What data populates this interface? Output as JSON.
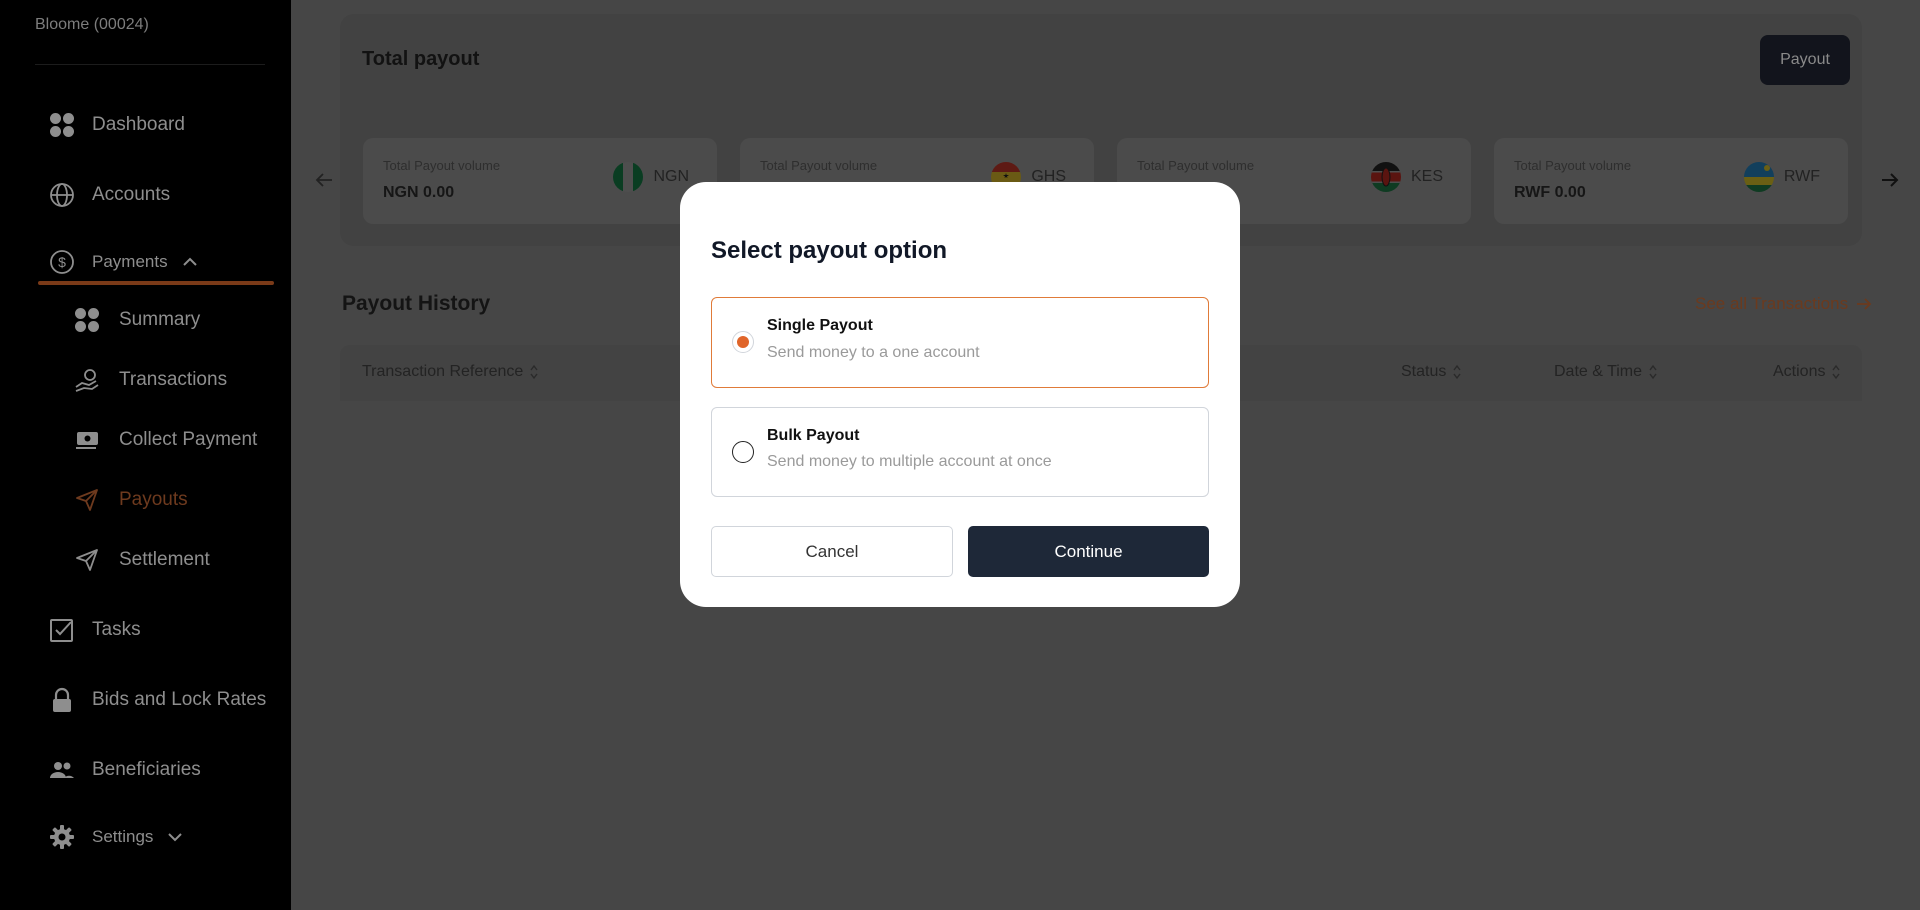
{
  "sidebar": {
    "org": "Bloome (00024)",
    "items": {
      "dashboard": "Dashboard",
      "accounts": "Accounts",
      "payments": "Payments",
      "summary": "Summary",
      "transactions": "Transactions",
      "collect_payment": "Collect Payment",
      "payouts": "Payouts",
      "settlement": "Settlement",
      "tasks": "Tasks",
      "bids": "Bids and Lock Rates",
      "beneficiaries": "Beneficiaries",
      "settings": "Settings"
    },
    "active_item": "Payouts",
    "accent_color": "#e0652a"
  },
  "main": {
    "total_title": "Total payout",
    "payout_button": "Payout",
    "volume_cards": [
      {
        "label": "Total Payout volume",
        "value": "NGN 0.00",
        "currency": "NGN"
      },
      {
        "label": "Total Payout volume",
        "value": "",
        "currency": "GHS"
      },
      {
        "label": "Total Payout volume",
        "value": "",
        "currency": "KES"
      },
      {
        "label": "Total Payout volume",
        "value": "RWF 0.00",
        "currency": "RWF"
      }
    ],
    "history_title": "Payout History",
    "see_all": "See all Transactions",
    "columns": {
      "reference": "Transaction Reference",
      "status": "Status",
      "datetime": "Date & Time",
      "actions": "Actions"
    }
  },
  "modal": {
    "title": "Select payout option",
    "options": [
      {
        "title": "Single Payout",
        "description": "Send money to a one account",
        "selected": true
      },
      {
        "title": "Bulk Payout",
        "description": "Send money to multiple account at once",
        "selected": false
      }
    ],
    "cancel": "Cancel",
    "continue": "Continue"
  }
}
